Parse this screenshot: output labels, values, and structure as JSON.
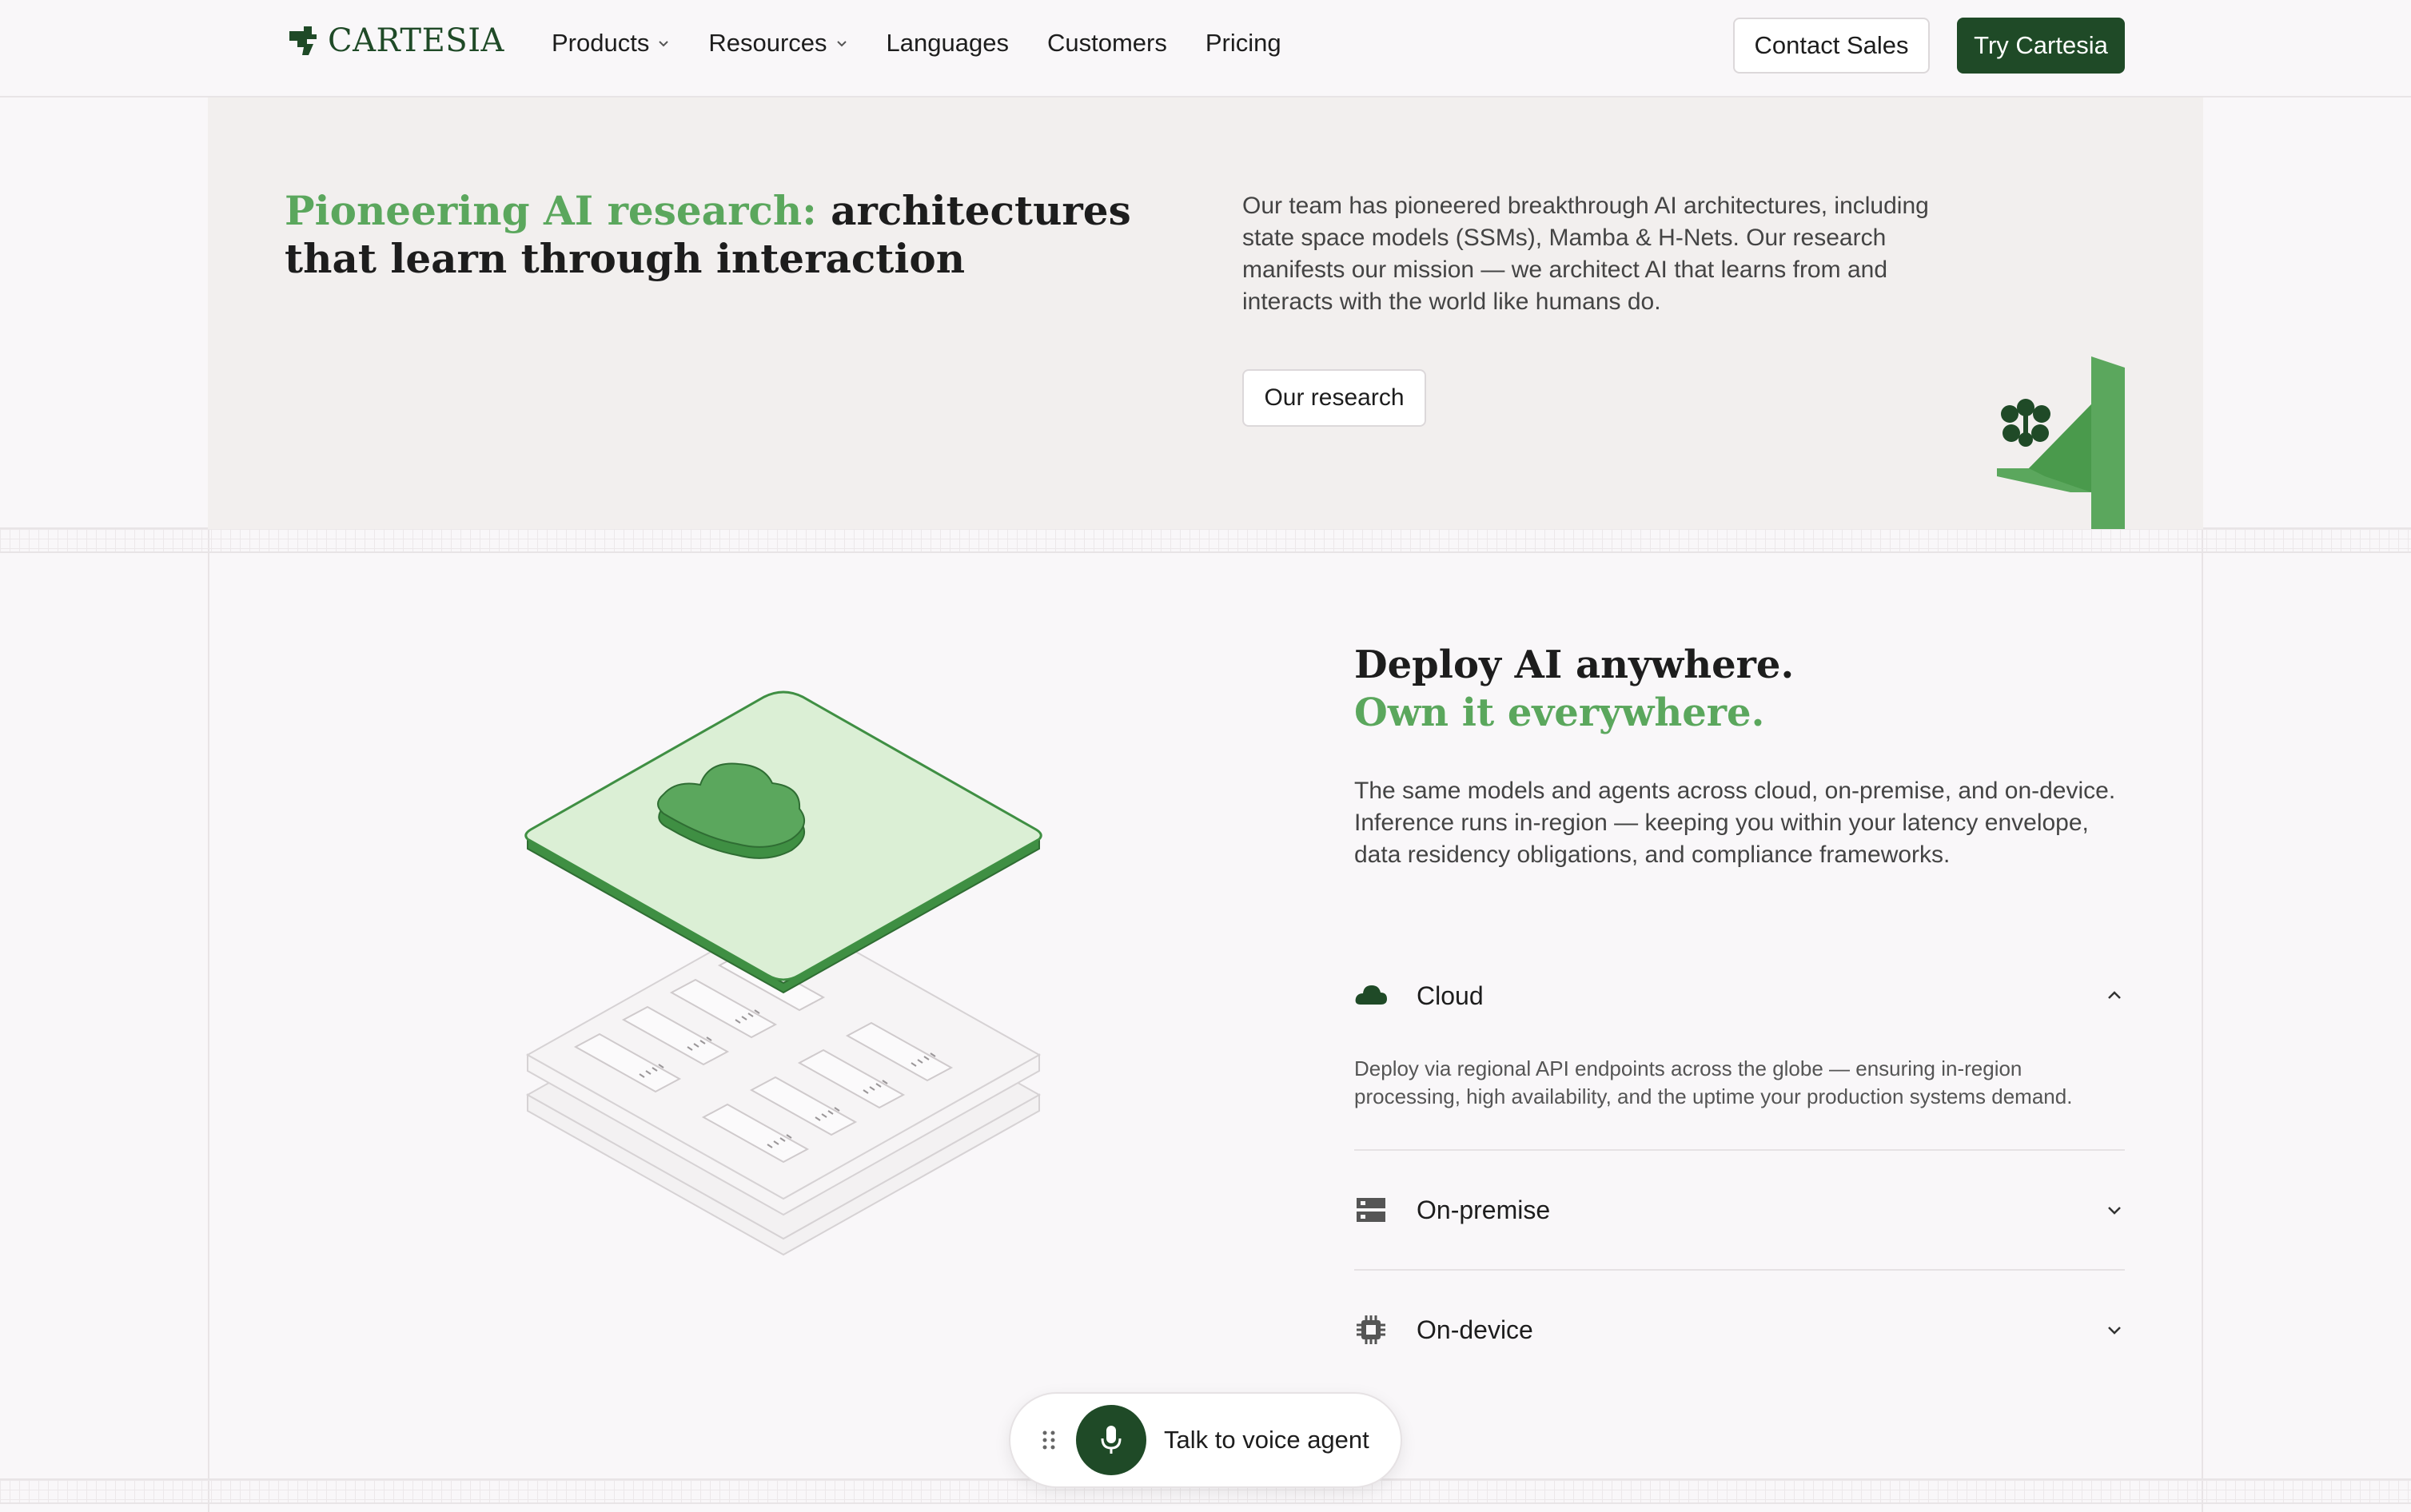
{
  "header": {
    "logo_text": "CARTESIA",
    "nav": [
      {
        "label": "Products",
        "has_dropdown": true
      },
      {
        "label": "Resources",
        "has_dropdown": true
      },
      {
        "label": "Languages",
        "has_dropdown": false
      },
      {
        "label": "Customers",
        "has_dropdown": false
      },
      {
        "label": "Pricing",
        "has_dropdown": false
      }
    ],
    "contact_label": "Contact Sales",
    "try_label": "Try Cartesia"
  },
  "research": {
    "title_accent": "Pioneering AI research:",
    "title_rest": " architectures that learn through interaction",
    "description": "Our team has pioneered breakthrough AI architectures, including state space models (SSMs), Mamba & H-Nets. Our research manifests our mission — we architect AI that learns from and interacts with the world like humans do.",
    "button_label": "Our research"
  },
  "deploy": {
    "title_line1": "Deploy AI anywhere.",
    "title_line2": "Own it everywhere.",
    "description": "The same models and agents across cloud, on-premise, and on-device. Inference runs in-region — keeping you within your latency envelope, data residency obligations, and compliance frameworks.",
    "options": [
      {
        "label": "Cloud",
        "icon": "cloud-icon",
        "expanded": true,
        "body": "Deploy via regional API endpoints across the globe — ensuring in-region processing, high availability, and the uptime your production systems demand."
      },
      {
        "label": "On-premise",
        "icon": "server-icon",
        "expanded": false
      },
      {
        "label": "On-device",
        "icon": "chip-icon",
        "expanded": false
      }
    ]
  },
  "voice_agent": {
    "label": "Talk to voice agent"
  },
  "colors": {
    "brand_dark": "#1f4a27",
    "brand_green": "#5ba75d",
    "light_green": "#dbefd5"
  }
}
